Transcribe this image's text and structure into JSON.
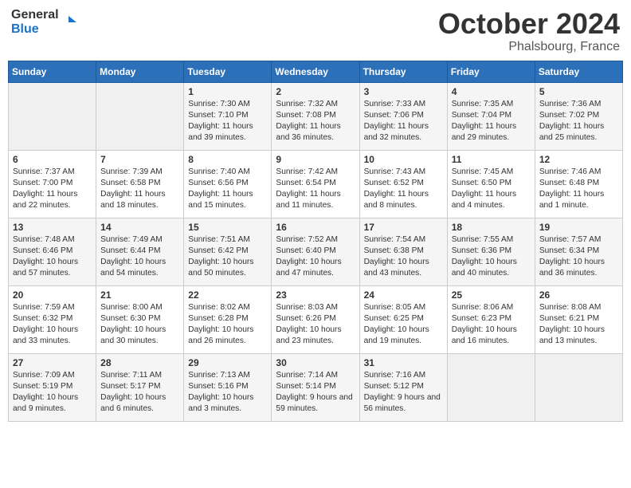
{
  "header": {
    "logo_line1": "General",
    "logo_line2": "Blue",
    "month": "October 2024",
    "location": "Phalsbourg, France"
  },
  "weekdays": [
    "Sunday",
    "Monday",
    "Tuesday",
    "Wednesday",
    "Thursday",
    "Friday",
    "Saturday"
  ],
  "weeks": [
    [
      {
        "day": "",
        "detail": ""
      },
      {
        "day": "",
        "detail": ""
      },
      {
        "day": "1",
        "detail": "Sunrise: 7:30 AM\nSunset: 7:10 PM\nDaylight: 11 hours and 39 minutes."
      },
      {
        "day": "2",
        "detail": "Sunrise: 7:32 AM\nSunset: 7:08 PM\nDaylight: 11 hours and 36 minutes."
      },
      {
        "day": "3",
        "detail": "Sunrise: 7:33 AM\nSunset: 7:06 PM\nDaylight: 11 hours and 32 minutes."
      },
      {
        "day": "4",
        "detail": "Sunrise: 7:35 AM\nSunset: 7:04 PM\nDaylight: 11 hours and 29 minutes."
      },
      {
        "day": "5",
        "detail": "Sunrise: 7:36 AM\nSunset: 7:02 PM\nDaylight: 11 hours and 25 minutes."
      }
    ],
    [
      {
        "day": "6",
        "detail": "Sunrise: 7:37 AM\nSunset: 7:00 PM\nDaylight: 11 hours and 22 minutes."
      },
      {
        "day": "7",
        "detail": "Sunrise: 7:39 AM\nSunset: 6:58 PM\nDaylight: 11 hours and 18 minutes."
      },
      {
        "day": "8",
        "detail": "Sunrise: 7:40 AM\nSunset: 6:56 PM\nDaylight: 11 hours and 15 minutes."
      },
      {
        "day": "9",
        "detail": "Sunrise: 7:42 AM\nSunset: 6:54 PM\nDaylight: 11 hours and 11 minutes."
      },
      {
        "day": "10",
        "detail": "Sunrise: 7:43 AM\nSunset: 6:52 PM\nDaylight: 11 hours and 8 minutes."
      },
      {
        "day": "11",
        "detail": "Sunrise: 7:45 AM\nSunset: 6:50 PM\nDaylight: 11 hours and 4 minutes."
      },
      {
        "day": "12",
        "detail": "Sunrise: 7:46 AM\nSunset: 6:48 PM\nDaylight: 11 hours and 1 minute."
      }
    ],
    [
      {
        "day": "13",
        "detail": "Sunrise: 7:48 AM\nSunset: 6:46 PM\nDaylight: 10 hours and 57 minutes."
      },
      {
        "day": "14",
        "detail": "Sunrise: 7:49 AM\nSunset: 6:44 PM\nDaylight: 10 hours and 54 minutes."
      },
      {
        "day": "15",
        "detail": "Sunrise: 7:51 AM\nSunset: 6:42 PM\nDaylight: 10 hours and 50 minutes."
      },
      {
        "day": "16",
        "detail": "Sunrise: 7:52 AM\nSunset: 6:40 PM\nDaylight: 10 hours and 47 minutes."
      },
      {
        "day": "17",
        "detail": "Sunrise: 7:54 AM\nSunset: 6:38 PM\nDaylight: 10 hours and 43 minutes."
      },
      {
        "day": "18",
        "detail": "Sunrise: 7:55 AM\nSunset: 6:36 PM\nDaylight: 10 hours and 40 minutes."
      },
      {
        "day": "19",
        "detail": "Sunrise: 7:57 AM\nSunset: 6:34 PM\nDaylight: 10 hours and 36 minutes."
      }
    ],
    [
      {
        "day": "20",
        "detail": "Sunrise: 7:59 AM\nSunset: 6:32 PM\nDaylight: 10 hours and 33 minutes."
      },
      {
        "day": "21",
        "detail": "Sunrise: 8:00 AM\nSunset: 6:30 PM\nDaylight: 10 hours and 30 minutes."
      },
      {
        "day": "22",
        "detail": "Sunrise: 8:02 AM\nSunset: 6:28 PM\nDaylight: 10 hours and 26 minutes."
      },
      {
        "day": "23",
        "detail": "Sunrise: 8:03 AM\nSunset: 6:26 PM\nDaylight: 10 hours and 23 minutes."
      },
      {
        "day": "24",
        "detail": "Sunrise: 8:05 AM\nSunset: 6:25 PM\nDaylight: 10 hours and 19 minutes."
      },
      {
        "day": "25",
        "detail": "Sunrise: 8:06 AM\nSunset: 6:23 PM\nDaylight: 10 hours and 16 minutes."
      },
      {
        "day": "26",
        "detail": "Sunrise: 8:08 AM\nSunset: 6:21 PM\nDaylight: 10 hours and 13 minutes."
      }
    ],
    [
      {
        "day": "27",
        "detail": "Sunrise: 7:09 AM\nSunset: 5:19 PM\nDaylight: 10 hours and 9 minutes."
      },
      {
        "day": "28",
        "detail": "Sunrise: 7:11 AM\nSunset: 5:17 PM\nDaylight: 10 hours and 6 minutes."
      },
      {
        "day": "29",
        "detail": "Sunrise: 7:13 AM\nSunset: 5:16 PM\nDaylight: 10 hours and 3 minutes."
      },
      {
        "day": "30",
        "detail": "Sunrise: 7:14 AM\nSunset: 5:14 PM\nDaylight: 9 hours and 59 minutes."
      },
      {
        "day": "31",
        "detail": "Sunrise: 7:16 AM\nSunset: 5:12 PM\nDaylight: 9 hours and 56 minutes."
      },
      {
        "day": "",
        "detail": ""
      },
      {
        "day": "",
        "detail": ""
      }
    ]
  ]
}
